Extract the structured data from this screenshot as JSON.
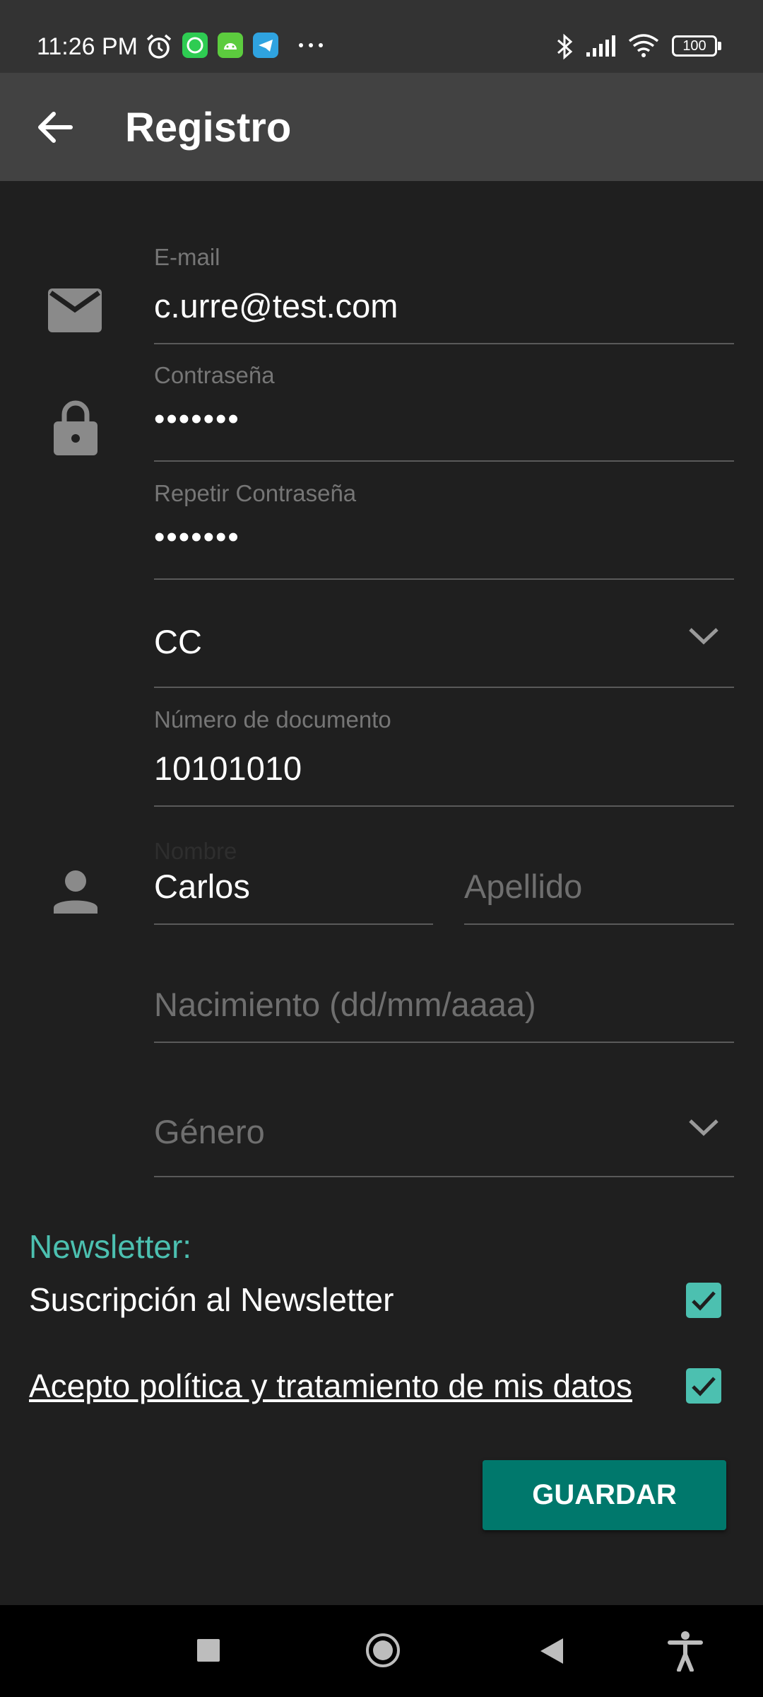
{
  "status_bar": {
    "time": "11:26 PM",
    "battery": "100",
    "icons": [
      "alarm-icon",
      "whatsapp-icon",
      "android-icon",
      "telegram-icon",
      "more-dots-icon",
      "bluetooth-icon",
      "signal-icon",
      "wifi-icon",
      "battery-icon"
    ]
  },
  "app_bar": {
    "title": "Registro",
    "back_icon": "arrow-back-icon"
  },
  "form": {
    "email": {
      "label": "E-mail",
      "value": "c.urre@test.com",
      "icon": "mail-icon"
    },
    "password": {
      "label": "Contraseña",
      "value": "•••••••",
      "icon": "lock-icon"
    },
    "repeat_password": {
      "label": "Repetir Contraseña",
      "value": "•••••••"
    },
    "document_type": {
      "value": "CC"
    },
    "document_number": {
      "label": "Número de documento",
      "value": "10101010"
    },
    "first_name": {
      "label": "Nombre",
      "value": "Carlos",
      "icon": "person-icon"
    },
    "last_name": {
      "placeholder": "Apellido"
    },
    "birth_date": {
      "placeholder": "Nacimiento (dd/mm/aaaa)"
    },
    "gender": {
      "placeholder": "Género"
    }
  },
  "newsletter": {
    "section_label": "Newsletter:",
    "subscription_label": "Suscripción al Newsletter",
    "subscription_checked": true,
    "policy_label": "Acepto política y tratamiento de mis datos",
    "policy_checked": true
  },
  "actions": {
    "save_label": "GUARDAR"
  },
  "colors": {
    "accent": "#4cc0b0",
    "button": "#00786c",
    "background": "#1f1f1f",
    "app_bar": "#424242"
  }
}
